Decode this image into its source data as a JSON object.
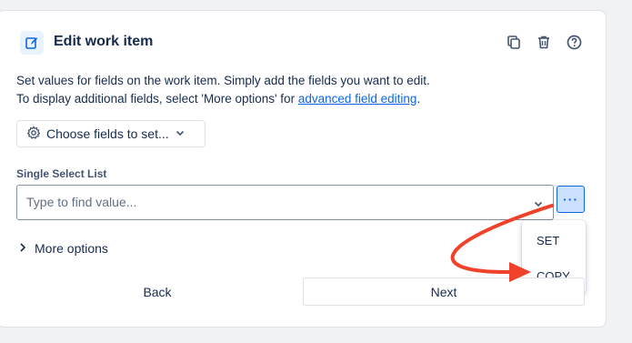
{
  "header": {
    "title": "Edit work item",
    "icons": [
      "edit-icon",
      "duplicate-icon",
      "trash-icon",
      "help-icon"
    ],
    "accent": "#0c66e4"
  },
  "description": {
    "line1": "Set values for fields on the work item. Simply add the fields you want to edit.",
    "line2_prefix": "To display additional fields, select 'More options' for ",
    "link": "advanced field editing",
    "line2_suffix": "."
  },
  "choose_fields": {
    "label": "Choose fields to set..."
  },
  "field": {
    "label": "Single Select List",
    "placeholder": "Type to find value...",
    "more_label": "···"
  },
  "dropdown": {
    "items": [
      "SET",
      "COPY"
    ]
  },
  "more_options": {
    "label": "More options"
  },
  "footer": {
    "back_label": "Back",
    "next_label": "Next"
  },
  "annotation": {
    "arrow_color": "#f0412a"
  }
}
